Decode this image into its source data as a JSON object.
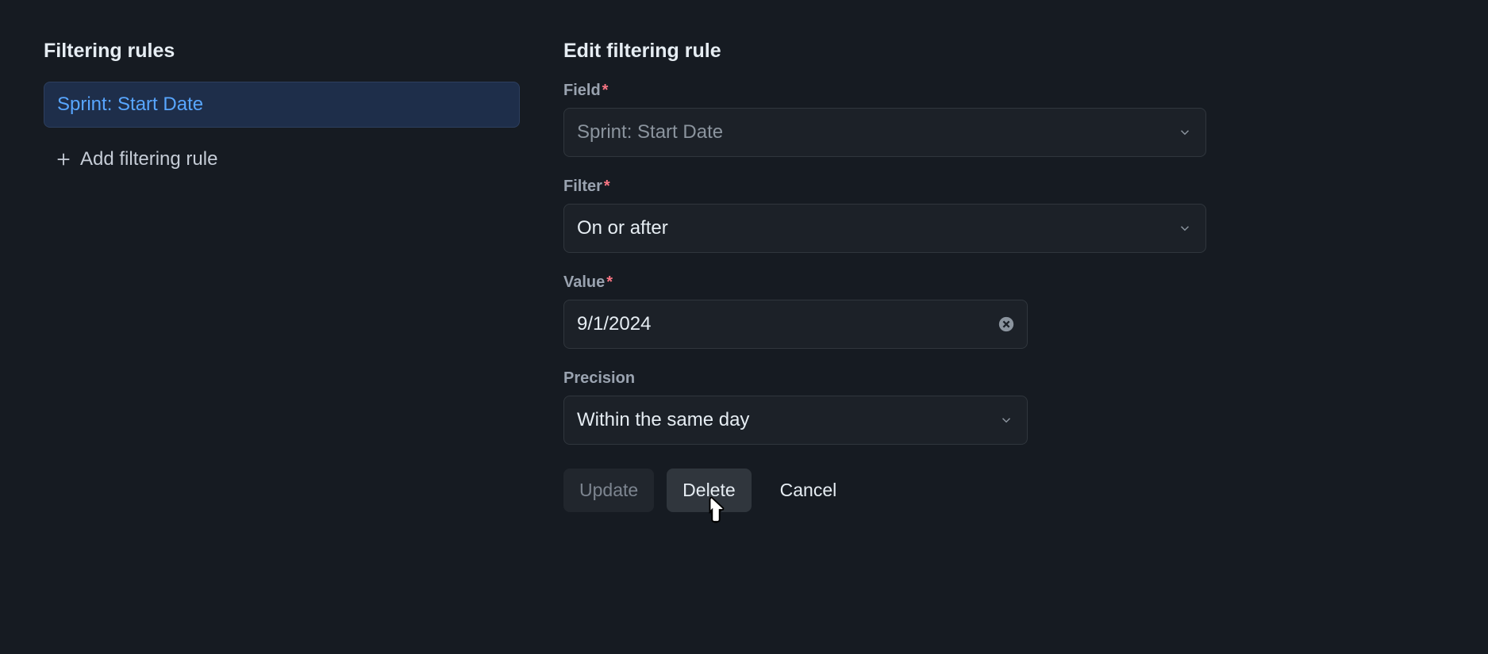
{
  "left": {
    "title": "Filtering rules",
    "rules": [
      {
        "label": "Sprint: Start Date"
      }
    ],
    "add_label": "Add filtering rule"
  },
  "right": {
    "title": "Edit filtering rule",
    "field": {
      "label": "Field",
      "value": "Sprint: Start Date"
    },
    "filter": {
      "label": "Filter",
      "value": "On or after"
    },
    "value": {
      "label": "Value",
      "value": "9/1/2024"
    },
    "precision": {
      "label": "Precision",
      "value": "Within the same day"
    },
    "buttons": {
      "update": "Update",
      "delete": "Delete",
      "cancel": "Cancel"
    }
  }
}
